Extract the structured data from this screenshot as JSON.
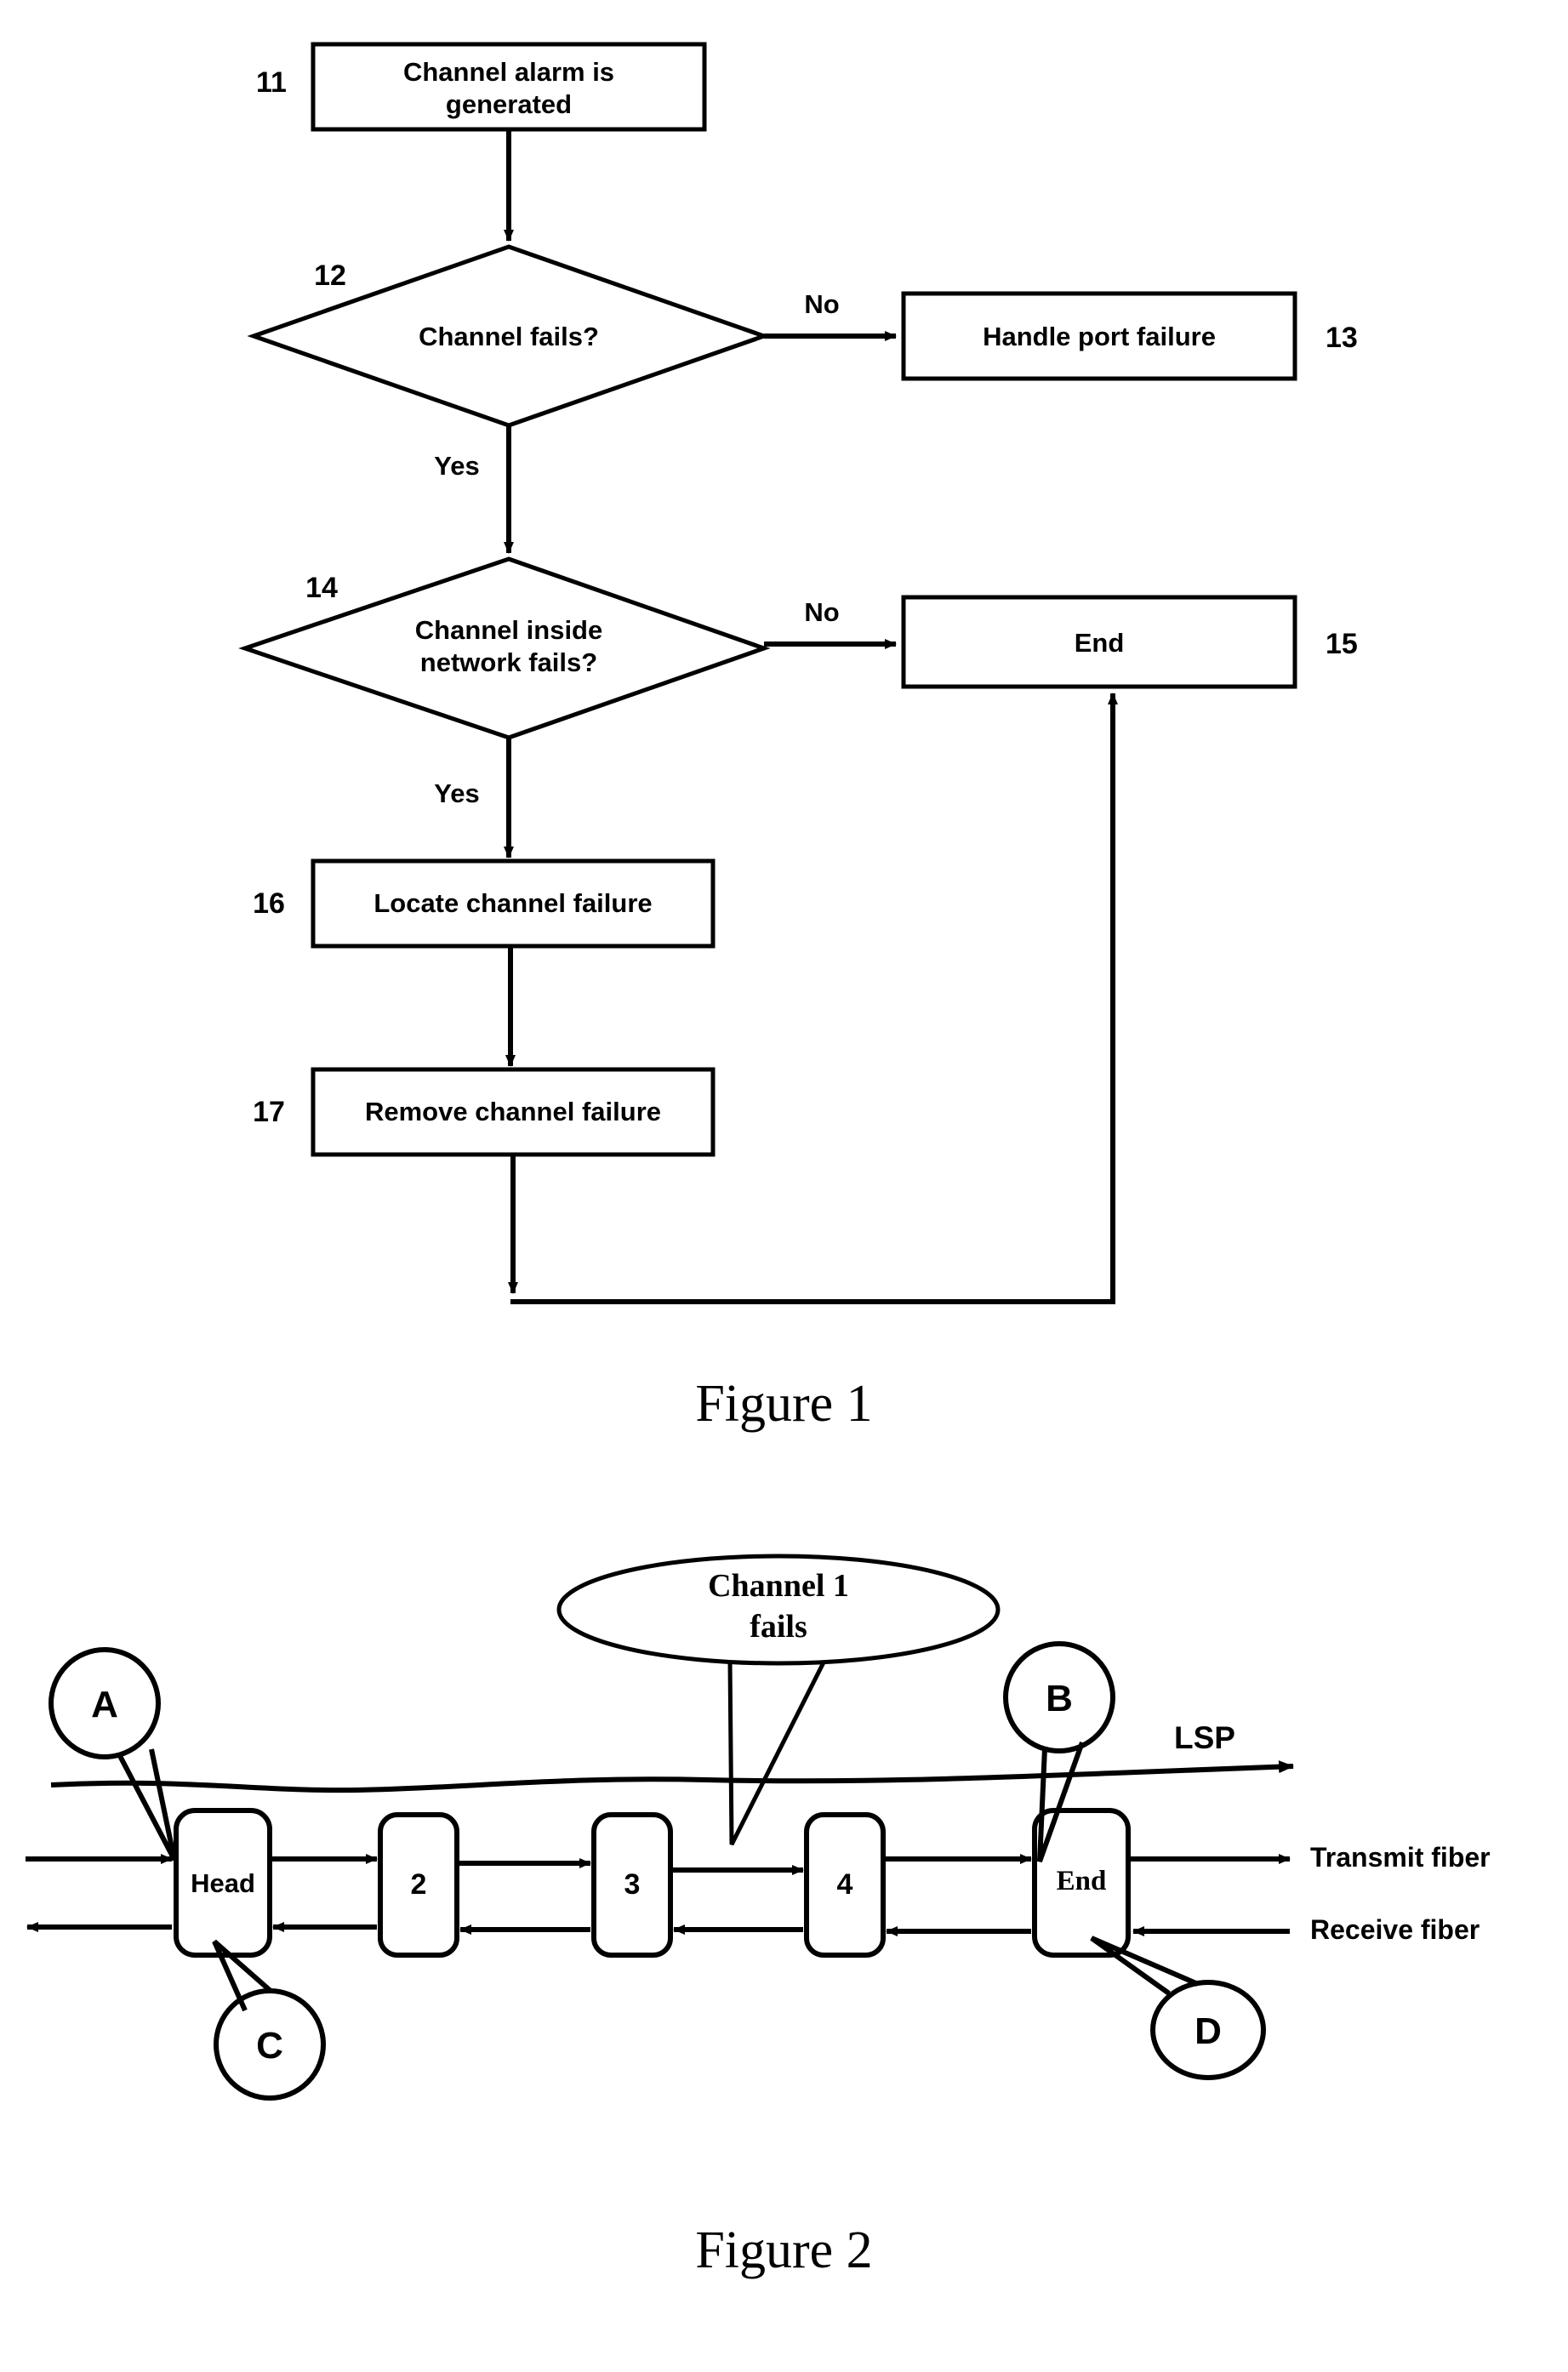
{
  "document": {
    "kind": "patent-drawing-sheet",
    "figures": [
      "Figure 1",
      "Figure 2"
    ]
  },
  "figure1": {
    "caption": "Figure 1",
    "nodes": [
      {
        "ref": "11",
        "type": "process",
        "lines": [
          "Channel alarm is",
          "generated"
        ]
      },
      {
        "ref": "12",
        "type": "decision",
        "lines": [
          "Channel fails?"
        ]
      },
      {
        "ref": "13",
        "type": "process",
        "lines": [
          "Handle port failure"
        ]
      },
      {
        "ref": "14",
        "type": "decision",
        "lines": [
          "Channel inside",
          "network fails?"
        ]
      },
      {
        "ref": "15",
        "type": "process",
        "lines": [
          "End"
        ]
      },
      {
        "ref": "16",
        "type": "process",
        "lines": [
          "Locate channel failure"
        ]
      },
      {
        "ref": "17",
        "type": "process",
        "lines": [
          "Remove channel failure"
        ]
      }
    ],
    "edge_labels": {
      "d12_no": "No",
      "d12_yes": "Yes",
      "d14_no": "No",
      "d14_yes": "Yes"
    }
  },
  "figure2": {
    "caption": "Figure 2",
    "callout": {
      "lines": [
        "Channel 1",
        "fails"
      ]
    },
    "lsp_label": "LSP",
    "nodes": [
      {
        "id": "head",
        "label": "Head"
      },
      {
        "id": "n2",
        "label": "2"
      },
      {
        "id": "n3",
        "label": "3"
      },
      {
        "id": "n4",
        "label": "4"
      },
      {
        "id": "end",
        "label": "End"
      }
    ],
    "markers": [
      {
        "id": "A",
        "label": "A"
      },
      {
        "id": "B",
        "label": "B"
      },
      {
        "id": "C",
        "label": "C"
      },
      {
        "id": "D",
        "label": "D"
      }
    ],
    "fiber_labels": {
      "transmit": "Transmit fiber",
      "receive": "Receive fiber"
    }
  },
  "colors": {
    "ink": "#000000",
    "paper": "#ffffff"
  }
}
